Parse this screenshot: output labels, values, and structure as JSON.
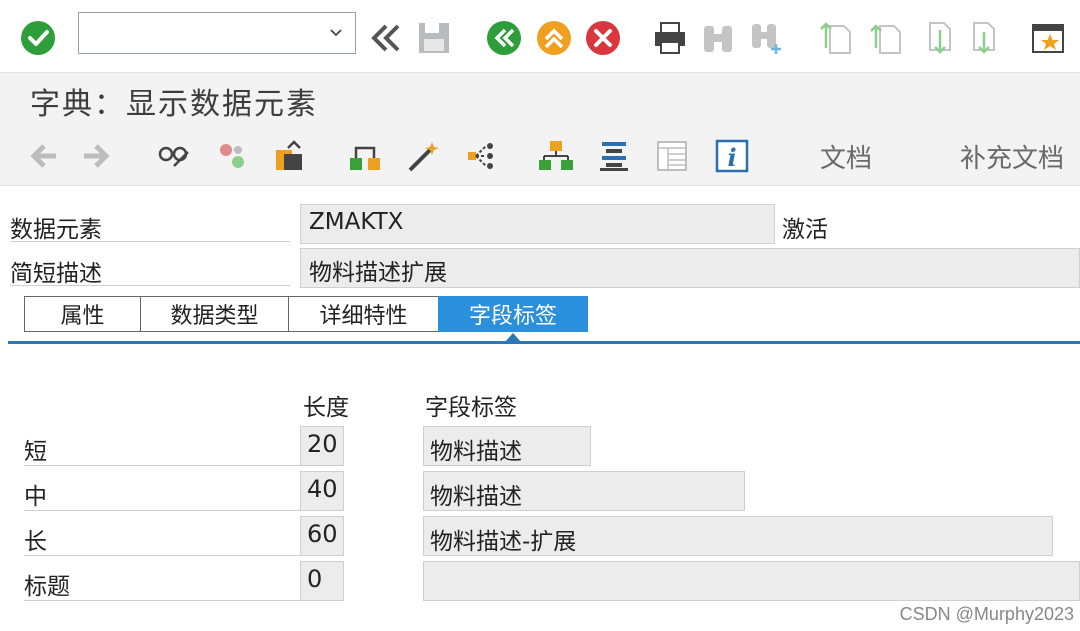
{
  "toolbar": {
    "command_placeholder": "",
    "icons": [
      "check-icon",
      "double-chevron-left-icon",
      "save-icon",
      "back-icon",
      "exit-icon",
      "cancel-icon",
      "print-icon",
      "find-icon",
      "find-next-icon",
      "first-page-icon",
      "previous-page-icon",
      "next-page-icon",
      "last-page-icon",
      "new-window-icon"
    ]
  },
  "title": "字典：显示数据元素",
  "app_toolbar": {
    "doc_label": "文档",
    "supplement_doc_label": "补充文档"
  },
  "header": {
    "data_element_label": "数据元素",
    "data_element_value": "ZMAKTX",
    "status": "激活",
    "short_desc_label": "简短描述",
    "short_desc_value": "物料描述扩展"
  },
  "tabs": [
    {
      "label": "属性",
      "active": false
    },
    {
      "label": "数据类型",
      "active": false
    },
    {
      "label": "详细特性",
      "active": false
    },
    {
      "label": "字段标签",
      "active": true
    }
  ],
  "field_labels": {
    "length_header": "长度",
    "label_header": "字段标签",
    "rows": [
      {
        "name": "短",
        "length": "20",
        "text": "物料描述"
      },
      {
        "name": "中",
        "length": "40",
        "text": "物料描述"
      },
      {
        "name": "长",
        "length": "60",
        "text": "物料描述-扩展"
      },
      {
        "name": "标题",
        "length": "0",
        "text": ""
      }
    ]
  },
  "colors": {
    "accent": "#2a8fdc",
    "ok_green": "#2e9e3a",
    "nav_orange": "#f0a020",
    "cancel_red": "#d9363e"
  },
  "watermark": "CSDN @Murphy2023"
}
